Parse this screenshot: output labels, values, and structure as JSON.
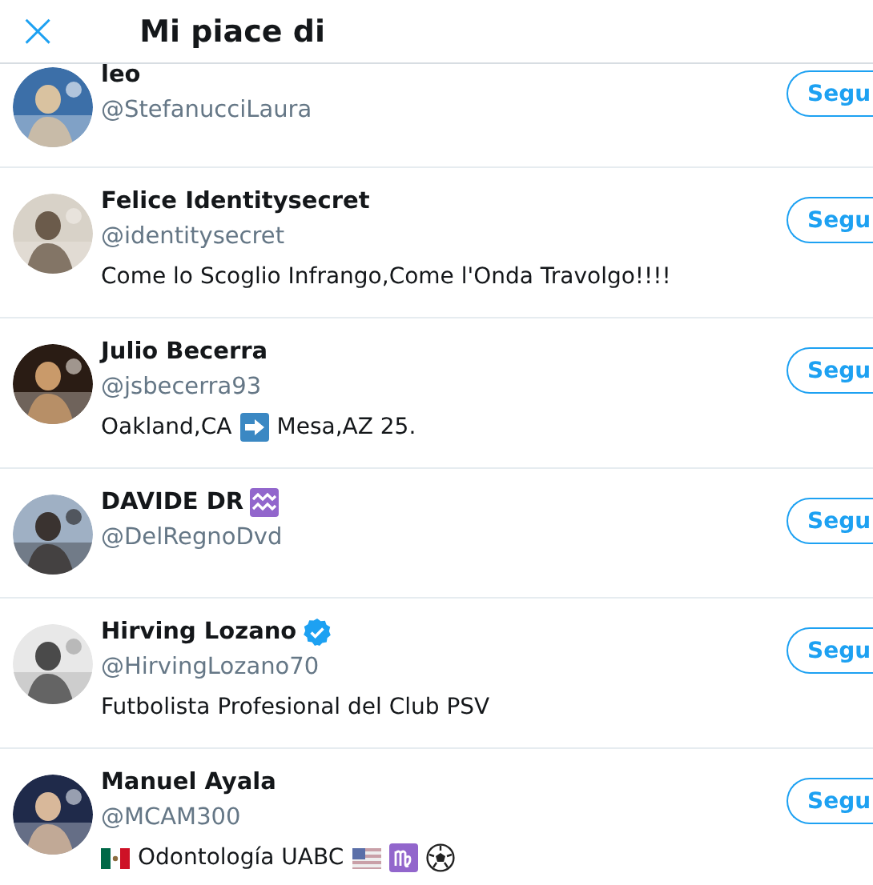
{
  "header": {
    "close": "×",
    "title": "Mi piace di"
  },
  "users": [
    {
      "name": "leo",
      "handle": "@StefanucciLaura",
      "button": "Segu"
    },
    {
      "name": "Felice Identitysecret",
      "handle": "@identitysecret",
      "button": "Segu",
      "bio": [
        {
          "kind": "text",
          "text": "Come lo Scoglio Infrango,Come l'Onda Travolgo!!!!"
        }
      ]
    },
    {
      "name": "Julio Becerra",
      "handle": "@jsbecerra93",
      "button": "Segu",
      "bio": [
        {
          "kind": "text",
          "text": "Oakland,CA"
        },
        {
          "kind": "arrow"
        },
        {
          "kind": "text",
          "text": "Mesa,AZ 25."
        }
      ]
    },
    {
      "name": "DAVIDE DR",
      "handle": "@DelRegnoDvd",
      "button": "Segu",
      "badge": {
        "kind": "aquarius"
      }
    },
    {
      "name": "Hirving Lozano",
      "handle": "@HirvingLozano70",
      "button": "Segu",
      "badge": {
        "kind": "verified"
      },
      "bio": [
        {
          "kind": "text",
          "text": "Futbolista Profesional del Club PSV"
        }
      ]
    },
    {
      "name": "Manuel Ayala",
      "handle": "@MCAM300",
      "button": "Segu",
      "bio": [
        {
          "kind": "flag-mx"
        },
        {
          "kind": "text",
          "text": "Odontología UABC"
        },
        {
          "kind": "flag-us"
        },
        {
          "kind": "virgo"
        },
        {
          "kind": "ball"
        }
      ]
    }
  ]
}
